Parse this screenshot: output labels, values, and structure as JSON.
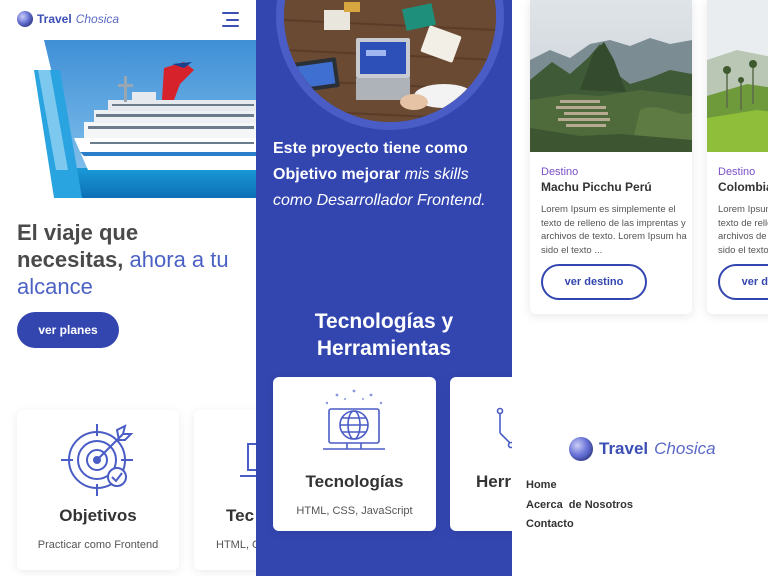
{
  "brand": {
    "name_bold": "Travel",
    "name_italic": "Chosica"
  },
  "hero": {
    "title_dark": "El viaje que necesitas,",
    "title_highlight": "ahora a tu alcance",
    "cta": "ver planes"
  },
  "features": [
    {
      "title": "Objetivos",
      "subtitle": "Practicar como Frontend",
      "icon": "target-icon"
    },
    {
      "title": "Tec",
      "subtitle": "HTML, C",
      "icon": "monitor-icon"
    }
  ],
  "project": {
    "statement_bold": "Este proyecto tiene como Objetivo mejorar",
    "statement_italic": "mis skills como Desarrollador Frontend."
  },
  "tech_section": {
    "heading": "Tecnologías y Herramientas",
    "cards": [
      {
        "title": "Tecnologías",
        "subtitle": "HTML, CSS, JavaScript",
        "icon": "globe-monitor-icon"
      },
      {
        "title": "Herr",
        "subtitle": "",
        "icon": "tools-icon"
      }
    ]
  },
  "destinations": [
    {
      "kicker": "Destino",
      "name": "Machu Picchu Perú",
      "text": "Lorem Ipsum es simplemente el texto de relleno de las imprentas y archivos de texto. Lorem Ipsum ha sido el texto ...",
      "cta": "ver destino"
    },
    {
      "kicker": "Destino",
      "name": "Colombia",
      "text": "Lorem Ipsum es simplemente el texto de relleno de las imprentas y archivos de texto. Lorem Ipsum ha sido el texto ...",
      "cta": "ver destino"
    }
  ],
  "footer": {
    "links": [
      "Home",
      "Acerca  de Nosotros",
      "Contacto"
    ]
  },
  "colors": {
    "primary": "#3346b0",
    "accent_text": "#4b62c4",
    "kicker": "#7b4fc7"
  }
}
